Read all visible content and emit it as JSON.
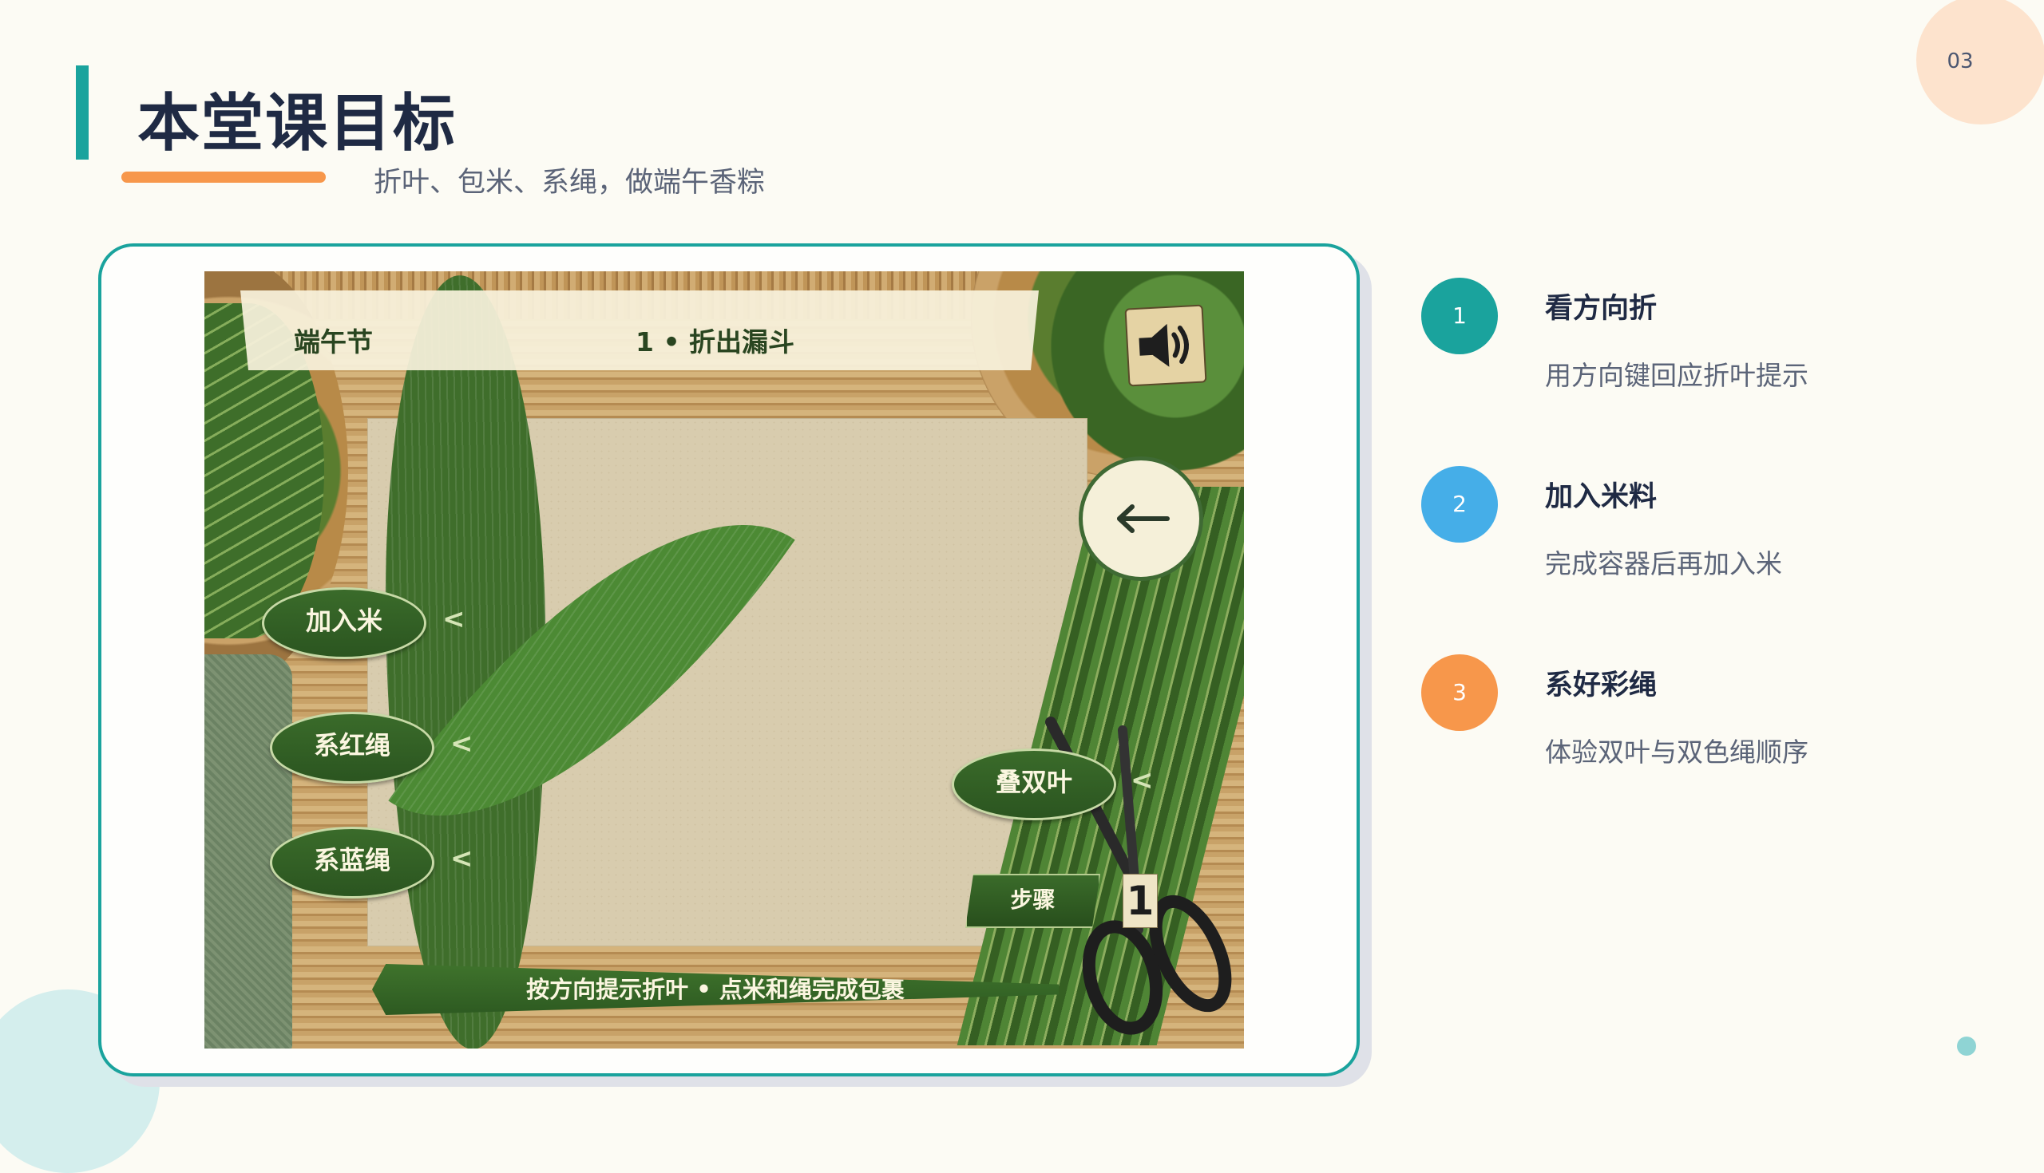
{
  "page_number": "03",
  "title": "本堂课目标",
  "subtitle": "折叶、包米、系绳，做端午香粽",
  "game": {
    "header_left": "端午节",
    "header_step": "1 • 折出漏斗",
    "sound_icon": "speaker-icon",
    "arrow_label": "←",
    "buttons": [
      {
        "label": "加入米"
      },
      {
        "label": "系红绳"
      },
      {
        "label": "系蓝绳"
      },
      {
        "label": "叠双叶"
      }
    ],
    "step_label": "步骤",
    "step_value": "1",
    "hint": "按方向提示折叶 • 点米和绳完成包裹"
  },
  "objectives": [
    {
      "num": "1",
      "title": "看方向折",
      "desc": "用方向键回应折叶提示",
      "color": "#1aa39d"
    },
    {
      "num": "2",
      "title": "加入米料",
      "desc": "完成容器后再加入米",
      "color": "#45aee8"
    },
    {
      "num": "3",
      "title": "系好彩绳",
      "desc": "体验双叶与双色绳顺序",
      "color": "#f7974b"
    }
  ]
}
